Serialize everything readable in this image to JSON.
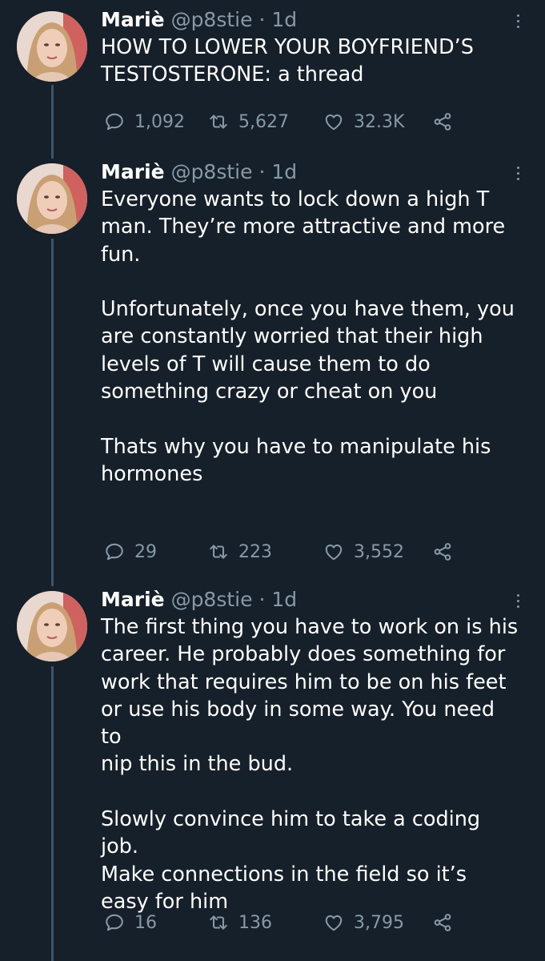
{
  "tweets": [
    {
      "name": "Mariè",
      "handle": "@p8stie",
      "separator": "·",
      "time": "1d",
      "text": "HOW TO LOWER YOUR BOYFRIEND’S\nTESTOSTERONE: a thread",
      "replies": "1,092",
      "retweets": "5,627",
      "likes": "32.3K"
    },
    {
      "name": "Mariè",
      "handle": "@p8stie",
      "separator": "·",
      "time": "1d",
      "text": "Everyone wants to lock down a high T\nman. They’re more attractive and more\nfun.\n\nUnfortunately, once you have them, you\nare constantly worried that their high\nlevels of T will cause them to do\nsomething crazy or cheat on you\n\nThats why you have to manipulate his\nhormones",
      "replies": "29",
      "retweets": "223",
      "likes": "3,552"
    },
    {
      "name": "Mariè",
      "handle": "@p8stie",
      "separator": "·",
      "time": "1d",
      "text": "The first thing you have to work on is his\ncareer. He probably does something for\nwork that requires him to be on his feet\nor use his body in some way. You need to\nnip this in the bud.\n\nSlowly convince him to take a coding job.\nMake connections in the field so it’s\neasy for him",
      "replies": "16",
      "retweets": "136",
      "likes": "3,795"
    }
  ],
  "icons": {
    "reply": "reply-icon",
    "retweet": "retweet-icon",
    "like": "heart-icon",
    "share": "share-icon",
    "more": "more-options-icon"
  },
  "colors": {
    "background": "#15202b",
    "text": "#ffffff",
    "secondary": "#8899a6",
    "thread_line": "#3d5466"
  }
}
